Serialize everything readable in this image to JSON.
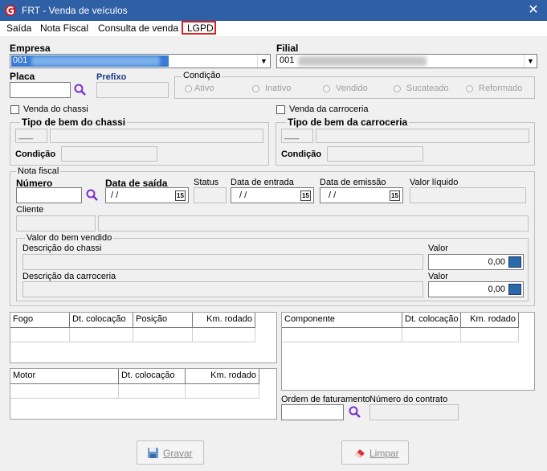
{
  "window": {
    "title": "FRT - Venda de veículos",
    "close": "✕"
  },
  "menu": {
    "items": [
      "Saída",
      "Nota Fiscal",
      "Consulta de venda",
      "LGPD"
    ]
  },
  "empresa": {
    "label": "Empresa",
    "value": "001"
  },
  "filial": {
    "label": "Filial",
    "value": "001"
  },
  "placa": {
    "label": "Placa"
  },
  "prefixo": {
    "label": "Prefixo"
  },
  "condicao": {
    "title": "Condição",
    "options": [
      "Ativo",
      "Inativo",
      "Vendido",
      "Sucateado",
      "Reformado"
    ]
  },
  "venda_chassi": {
    "label": "Venda do chassi"
  },
  "venda_carroceria": {
    "label": "Venda da carroceria"
  },
  "tipo_chassi": {
    "title": "Tipo de bem do chassi",
    "code": "___",
    "condicao_label": "Condição"
  },
  "tipo_carroceria": {
    "title": "Tipo de bem da carroceria",
    "code": "___",
    "condicao_label": "Condição"
  },
  "nota_fiscal": {
    "title": "Nota fiscal",
    "numero_label": "Número",
    "data_saida_label": "Data de saída",
    "data_saida": " / /",
    "status_label": "Status",
    "data_entrada_label": "Data de entrada",
    "data_entrada": " / /",
    "data_emissao_label": "Data de emissão",
    "data_emissao": " / /",
    "valor_liquido_label": "Valor líquido",
    "cliente_label": "Cliente",
    "cal_glyph": "15"
  },
  "valor_bem": {
    "title": "Valor do bem vendido",
    "desc_chassi_label": "Descrição do chassi",
    "desc_carroceria_label": "Descrição da carroceria",
    "valor_label": "Valor",
    "valor_chassi": "0,00",
    "valor_carroceria": "0,00"
  },
  "fogo_grid": {
    "headers": [
      "Fogo",
      "Dt. colocação",
      "Posição",
      "Km. rodado"
    ]
  },
  "motor_grid": {
    "headers": [
      "Motor",
      "Dt. colocação",
      "Km. rodado"
    ]
  },
  "componente_grid": {
    "headers": [
      "Componente",
      "Dt. colocação",
      "Km. rodado"
    ]
  },
  "ordem_faturamento": {
    "label": "Ordem de faturamento"
  },
  "numero_contrato": {
    "label": "Número do contrato"
  },
  "buttons": {
    "gravar": "Gravar",
    "limpar": "Limpar"
  },
  "colors": {
    "title_bar": "#2f5fa5",
    "prefixo_label": "#1c3a8a",
    "highlight": "#e02020",
    "search_icon": "#7a2fd0",
    "selection_blue": "#3a7bd5"
  }
}
